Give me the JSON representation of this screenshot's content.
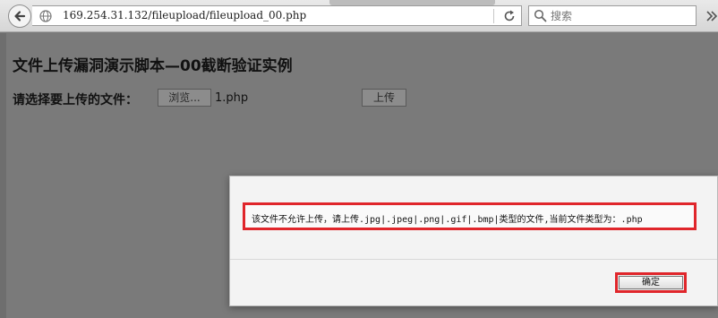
{
  "browser": {
    "url": "169.254.31.132/fileupload/fileupload_00.php",
    "search_placeholder": "搜索"
  },
  "page": {
    "title": "文件上传漏洞演示脚本—00截断验证实例",
    "upload_label": "请选择要上传的文件：",
    "browse_label": "浏览...",
    "file_name": "1.php",
    "submit_label": "上传"
  },
  "dialog": {
    "message": "该文件不允许上传，请上传.jpg|.jpeg|.png|.gif|.bmp|类型的文件,当前文件类型为：.php",
    "ok_label": "确定"
  },
  "colors": {
    "highlight": "#e0262b",
    "overlay": "#7a7a7a"
  }
}
